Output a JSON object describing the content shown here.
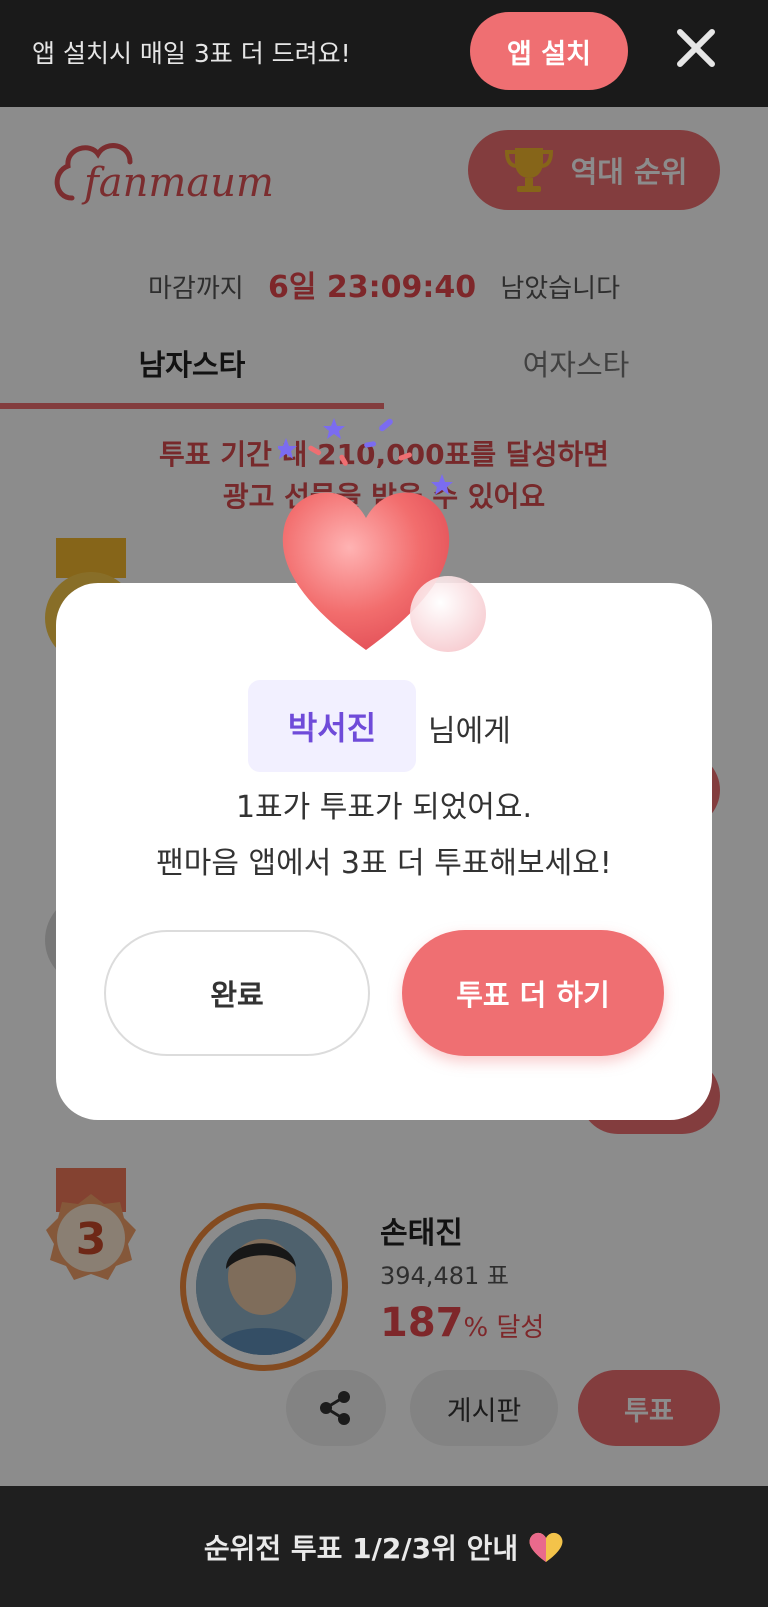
{
  "banner": {
    "message": "앱 설치시 매일 3표 더 드려요!",
    "install_label": "앱 설치",
    "close_icon": "close-icon"
  },
  "header": {
    "logo_text": "fanmaum",
    "hall_of_fame_label": "역대 순위"
  },
  "deadline": {
    "prefix": "마감까지",
    "time": "6일 23:09:40",
    "suffix": "남았습니다"
  },
  "tabs": [
    {
      "label": "남자스타",
      "selected": true
    },
    {
      "label": "여자스타",
      "selected": false
    }
  ],
  "goal": {
    "line1": "투표 기간 내 210,000표를 달성하면",
    "line2": "광고 선물을 받을 수 있어요"
  },
  "rank3": {
    "rank": "3",
    "name": "손태진",
    "votes": "394,481 표",
    "percent": "187",
    "percent_suffix": "% 달성",
    "board_label": "게시판",
    "vote_label": "투표"
  },
  "bottom_bar": {
    "label": "순위전 투표 1/2/3위 안내"
  },
  "modal": {
    "recipient_name": "박서진",
    "recipient_suffix": "님에게",
    "line1": "1표가 투표가 되었어요.",
    "line2": "팬마음 앱에서 3표 더 투표해보세요!",
    "done_label": "완료",
    "more_label": "투표 더 하기"
  },
  "colors": {
    "accent": "#ef6f72",
    "name_purple": "#6f4bd9"
  }
}
